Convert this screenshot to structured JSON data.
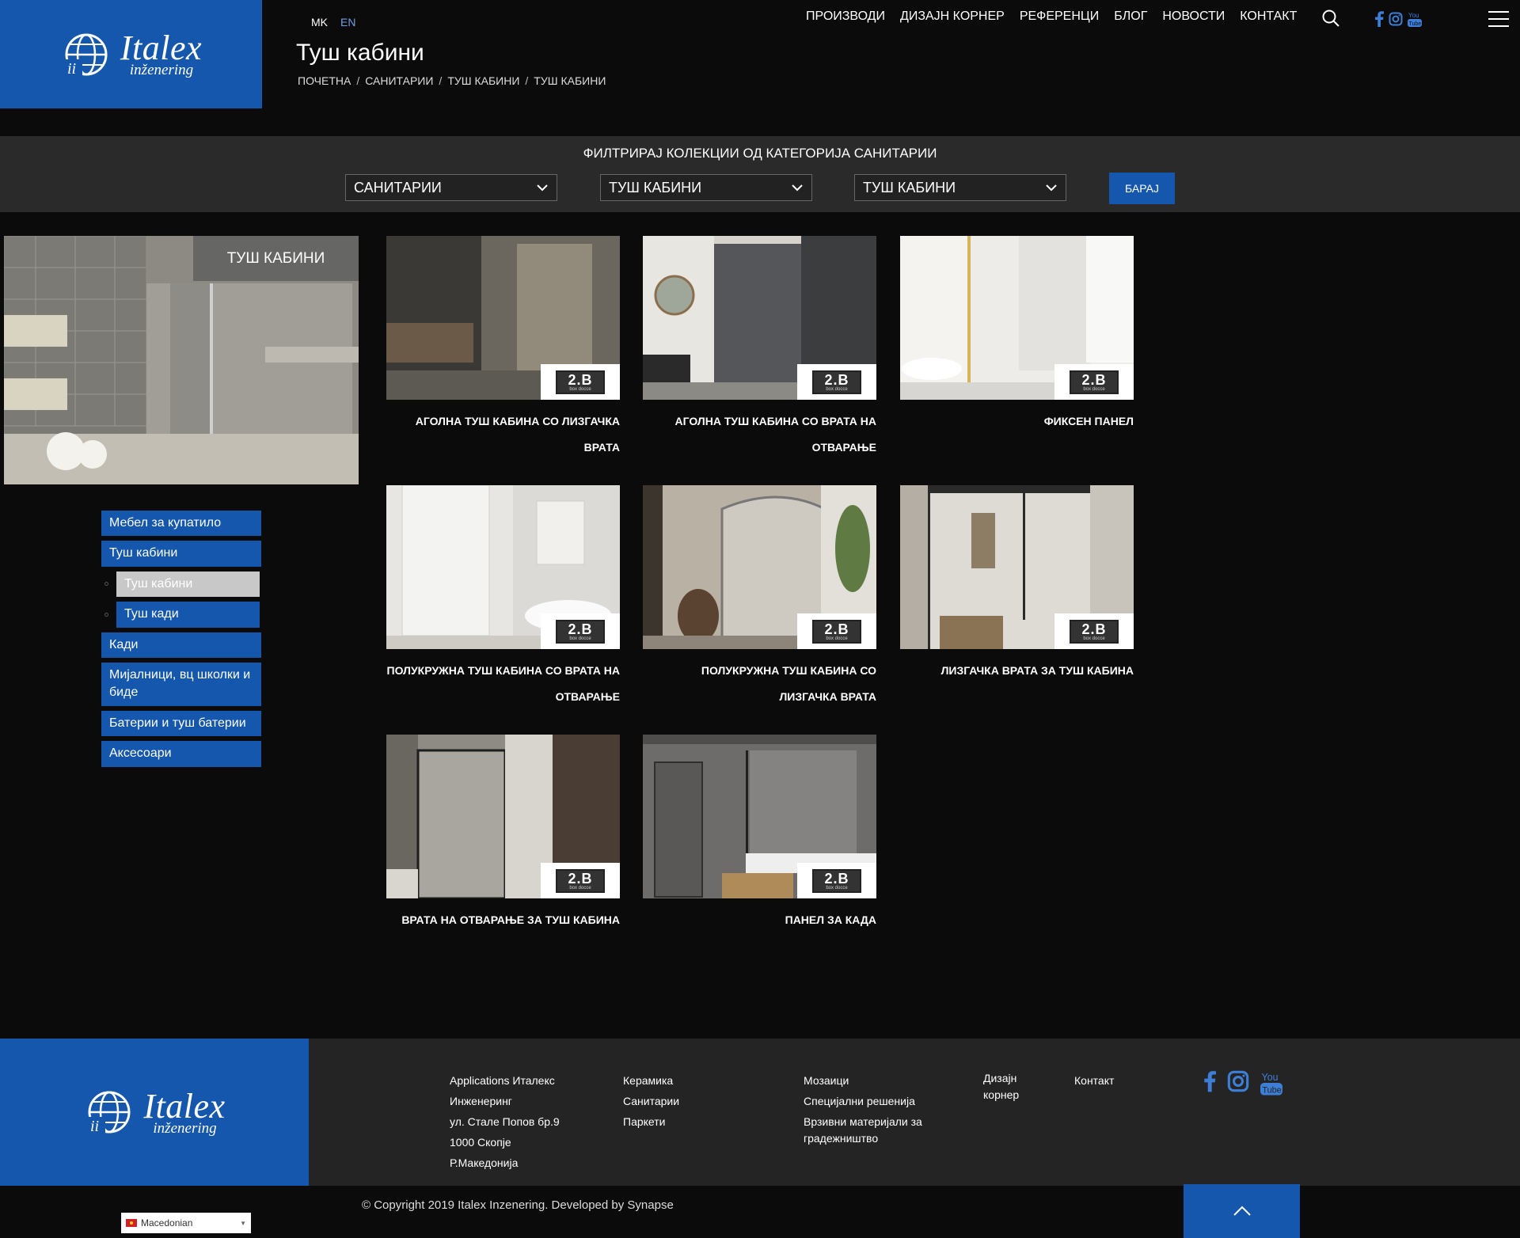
{
  "colors": {
    "brand_blue": "#1557ad",
    "background": "#0b0b0b",
    "filter_bg": "#2a2a2a",
    "footer_bg": "#242424",
    "active_gray": "#c8c8c8",
    "lang_active": "#6f9fe6"
  },
  "header": {
    "logo": {
      "word": "Italex",
      "sub": "inženering"
    },
    "lang": {
      "mk": "MK",
      "en": "EN"
    },
    "title": "Туш кабини",
    "breadcrumb": [
      "ПОЧЕТНА",
      "САНИТАРИИ",
      "ТУШ КАБИНИ",
      "ТУШ КАБИНИ"
    ],
    "breadcrumb_sep": "/",
    "nav": [
      "ПРОИЗВОДИ",
      "ДИЗАЈН КОРНЕР",
      "РЕФЕРЕНЦИ",
      "БЛОГ",
      "НОВОСТИ",
      "КОНТАКТ"
    ],
    "icons": [
      "search-icon",
      "facebook-icon",
      "instagram-icon",
      "youtube-icon",
      "menu-icon"
    ]
  },
  "filter": {
    "title": "ФИЛТРИРАЈ КОЛЕКЦИИ ОД КАТЕГОРИЈА САНИТАРИИ",
    "select1": "САНИТАРИИ",
    "select2": "ТУШ КАБИНИ",
    "select3": "ТУШ КАБИНИ",
    "button": "БАРАЈ"
  },
  "sidebar": {
    "hero_label": "ТУШ КАБИНИ",
    "items": [
      {
        "label": "Мебел за купатило"
      },
      {
        "label": "Туш кабини"
      },
      {
        "label": "Туш кабини",
        "sub": true,
        "active": true
      },
      {
        "label": "Туш кади",
        "sub": true
      },
      {
        "label": "Кади"
      },
      {
        "label": "Мијалници, вц школки и биде"
      },
      {
        "label": "Батерии и туш батерии"
      },
      {
        "label": "Аксесоари"
      }
    ]
  },
  "products": [
    {
      "name": "АГОЛНА ТУШ КАБИНА СО ЛИЗГАЧКА ВРАТА",
      "brand": "2.B",
      "brand_sub": "box docce"
    },
    {
      "name": "АГОЛНА ТУШ КАБИНА СО ВРАТА НА ОТВАРАЊЕ",
      "brand": "2.B",
      "brand_sub": "box docce"
    },
    {
      "name": "ФИКСЕН ПАНЕЛ",
      "brand": "2.B",
      "brand_sub": "box docce"
    },
    {
      "name": "ПОЛУКРУЖНА ТУШ КАБИНА СО ВРАТА НА ОТВАРАЊЕ",
      "brand": "2.B",
      "brand_sub": "box docce"
    },
    {
      "name": "ПОЛУКРУЖНА ТУШ КАБИНА СО ЛИЗГАЧКА ВРАТА",
      "brand": "2.B",
      "brand_sub": "box docce"
    },
    {
      "name": "ЛИЗГАЧКА ВРАТА ЗА ТУШ КАБИНА",
      "brand": "2.B",
      "brand_sub": "box docce"
    },
    {
      "name": "ВРАТА НА ОТВАРАЊЕ ЗА ТУШ КАБИНА",
      "brand": "2.B",
      "brand_sub": "box docce"
    },
    {
      "name": "ПАНЕЛ ЗА КАДА",
      "brand": "2.B",
      "brand_sub": "box docce"
    }
  ],
  "footer": {
    "address": [
      "Applications Италекс Инженеринг",
      "ул. Стале Попов бр.9",
      "1000 Скопје",
      "Р.Македонија"
    ],
    "col2": [
      "Керамика",
      "Санитарии",
      "Паркети"
    ],
    "col3": [
      "Мозаици",
      "Специјални решенија",
      "Врзивни материјали за градежништво"
    ],
    "col4": [
      "Дизајн корнер"
    ],
    "col5": [
      "Контакт"
    ],
    "copyright": "© Copyright 2019 Italex Inzenering. Developed by Synapse",
    "language": "Macedonian"
  }
}
